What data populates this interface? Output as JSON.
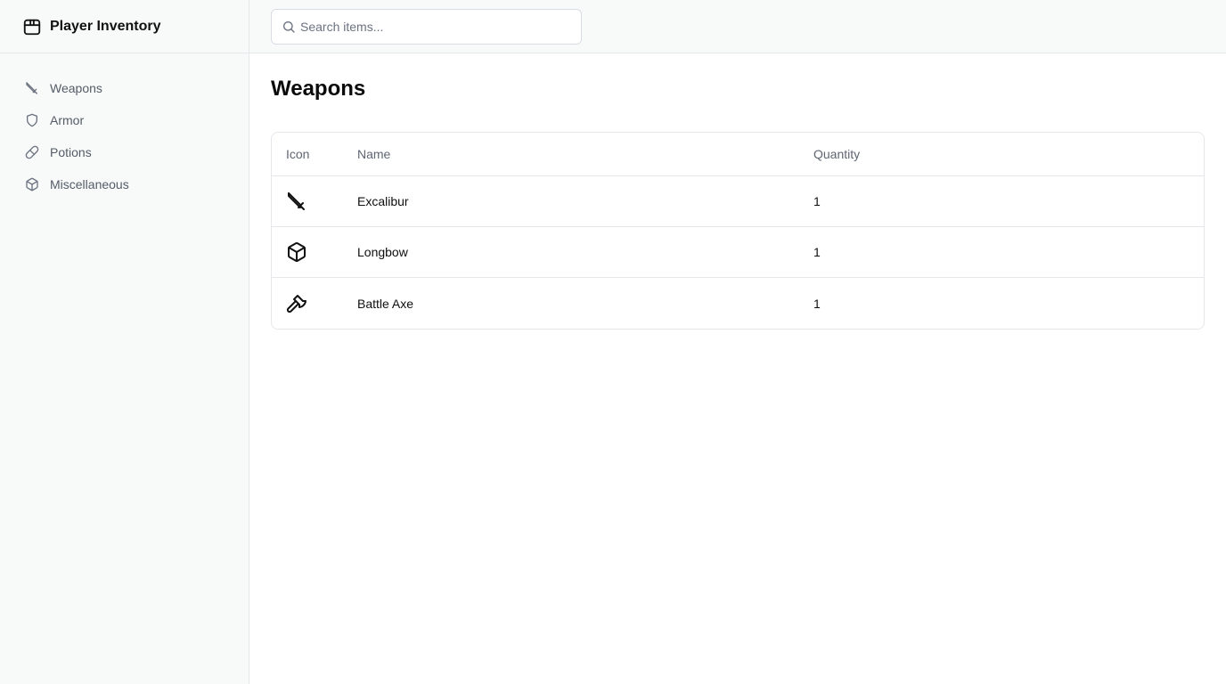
{
  "app": {
    "title": "Player Inventory",
    "icon": "package-icon"
  },
  "sidebar": {
    "items": [
      {
        "label": "Weapons",
        "icon": "sword-icon"
      },
      {
        "label": "Armor",
        "icon": "shield-icon"
      },
      {
        "label": "Potions",
        "icon": "pill-icon"
      },
      {
        "label": "Miscellaneous",
        "icon": "box-icon"
      }
    ]
  },
  "search": {
    "placeholder": "Search items...",
    "value": "",
    "icon": "search-icon"
  },
  "main": {
    "title": "Weapons",
    "table": {
      "headers": [
        "Icon",
        "Name",
        "Quantity"
      ],
      "rows": [
        {
          "icon": "sword-icon",
          "name": "Excalibur",
          "quantity": "1"
        },
        {
          "icon": "box-icon",
          "name": "Longbow",
          "quantity": "1"
        },
        {
          "icon": "axe-icon",
          "name": "Battle Axe",
          "quantity": "1"
        }
      ]
    }
  },
  "colors": {
    "sidebar_bg": "#f8faf9",
    "border": "#e5e7eb",
    "muted_text": "#555c68",
    "text": "#111111"
  }
}
